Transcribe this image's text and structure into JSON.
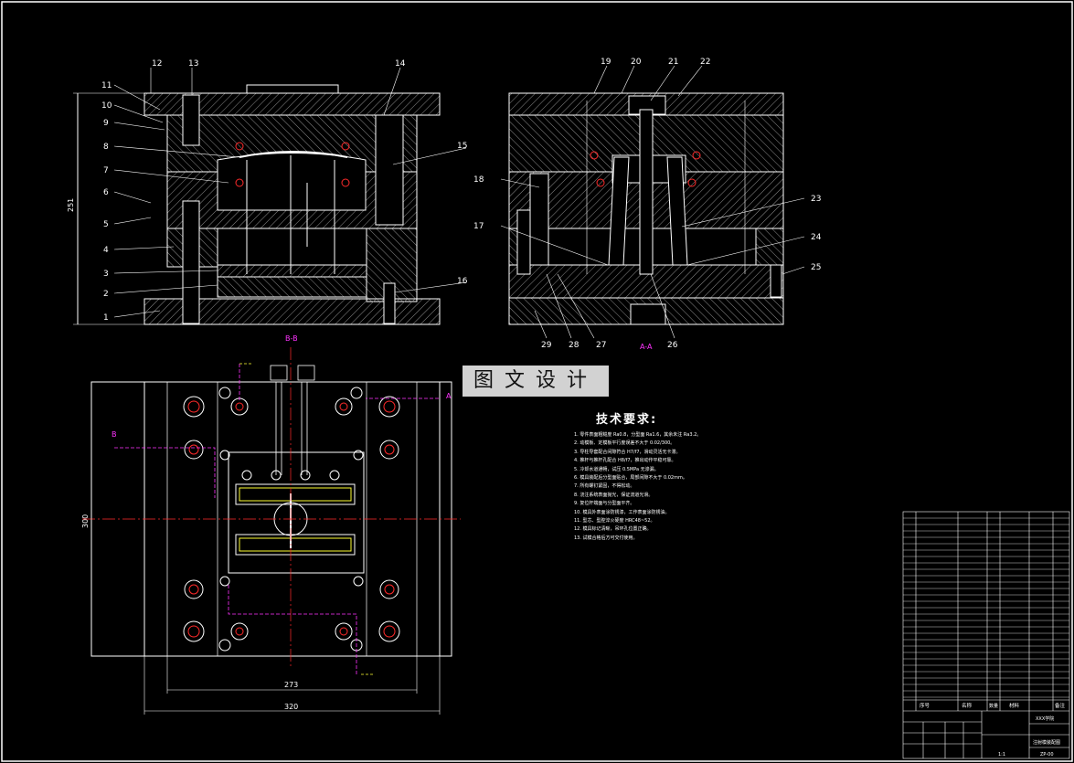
{
  "callouts_left": [
    "1",
    "2",
    "3",
    "4",
    "5",
    "6",
    "7",
    "8",
    "9",
    "10",
    "11",
    "12",
    "13",
    "14",
    "15",
    "16"
  ],
  "callouts_right": [
    "17",
    "18",
    "19",
    "20",
    "21",
    "22",
    "23",
    "24",
    "25",
    "26",
    "27",
    "28",
    "29"
  ],
  "section_labels": {
    "left": "B-B",
    "right": "A-A",
    "plan_b": "B",
    "plan_a": "A"
  },
  "dimensions": {
    "height_left": "251",
    "plan_height": "300",
    "plan_inner_width": "273",
    "plan_outer_width": "320"
  },
  "watermark": "图文设计",
  "tech": {
    "title": "技术要求:",
    "items": [
      "1. 零件表面粗糙度 Ra0.8，分型面 Ra1.6，其余未注 Ra3.2。",
      "2. 动模板、定模板平行度误差不大于 0.02/300。",
      "3. 导柱导套配合间隙符合 H7/f7，滑动灵活无卡滞。",
      "4. 推杆与推杆孔配合 H8/f7，推出动作平稳可靠。",
      "5. 冷却水道通畅，试压 0.5MPa 无渗漏。",
      "6. 模具装配后分型面贴合，局部间隙不大于 0.02mm。",
      "7. 所有螺钉紧固，不得松动。",
      "8. 浇注系统表面抛光，保证流道光滑。",
      "9. 复位杆端面与分型面平齐。",
      "10. 模具外表面涂防锈漆，工作表面涂防锈油。",
      "11. 型芯、型腔淬火硬度 HRC48~52。",
      "12. 模具标记清晰，吊环孔位置正确。",
      "13. 试模合格后方可交付使用。"
    ]
  },
  "title_block": {
    "header_left": "序号",
    "header_mid": "名称",
    "header_qty": "数量",
    "header_mat": "材料",
    "header_note": "备注",
    "school": "XXX学院",
    "drawing": "注射模装配图",
    "code": "ZP-00",
    "scale": "1:1"
  },
  "colors": {
    "line": "#ffffff",
    "hatch": "#9a9a9a",
    "red": "#ff2a2a",
    "magenta": "#ff33ff",
    "yellow": "#ffff33",
    "cyan": "#33ffff"
  }
}
